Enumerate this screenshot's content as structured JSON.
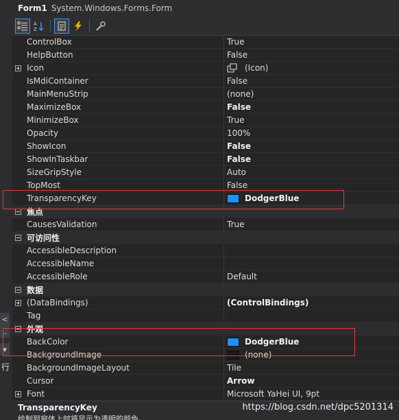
{
  "title": {
    "name": "Form1",
    "type": "System.Windows.Forms.Form"
  },
  "toolbar": {
    "buttons": [
      "categorized-icon",
      "alphabetical-icon",
      "properties-icon",
      "events-icon",
      "property-pages-icon"
    ]
  },
  "rows": [
    {
      "kind": "prop",
      "name": "ControlBox",
      "value": "True",
      "bold": false
    },
    {
      "kind": "prop",
      "name": "HelpButton",
      "value": "False",
      "bold": false
    },
    {
      "kind": "prop",
      "name": "Icon",
      "value": "(Icon)",
      "bold": false,
      "expandable": true,
      "icon": "icon-preview"
    },
    {
      "kind": "prop",
      "name": "IsMdiContainer",
      "value": "False",
      "bold": false
    },
    {
      "kind": "prop",
      "name": "MainMenuStrip",
      "value": "(none)",
      "bold": false
    },
    {
      "kind": "prop",
      "name": "MaximizeBox",
      "value": "False",
      "bold": true
    },
    {
      "kind": "prop",
      "name": "MinimizeBox",
      "value": "True",
      "bold": false
    },
    {
      "kind": "prop",
      "name": "Opacity",
      "value": "100%",
      "bold": false
    },
    {
      "kind": "prop",
      "name": "ShowIcon",
      "value": "False",
      "bold": true
    },
    {
      "kind": "prop",
      "name": "ShowInTaskbar",
      "value": "False",
      "bold": true
    },
    {
      "kind": "prop",
      "name": "SizeGripStyle",
      "value": "Auto",
      "bold": false
    },
    {
      "kind": "prop",
      "name": "TopMost",
      "value": "False",
      "bold": false
    },
    {
      "kind": "prop",
      "name": "TransparencyKey",
      "value": "DodgerBlue",
      "bold": true,
      "swatch": "#1e90ff"
    },
    {
      "kind": "cat",
      "name": "焦点"
    },
    {
      "kind": "prop",
      "name": "CausesValidation",
      "value": "True",
      "bold": false
    },
    {
      "kind": "cat",
      "name": "可访问性"
    },
    {
      "kind": "prop",
      "name": "AccessibleDescription",
      "value": "",
      "bold": false
    },
    {
      "kind": "prop",
      "name": "AccessibleName",
      "value": "",
      "bold": false
    },
    {
      "kind": "prop",
      "name": "AccessibleRole",
      "value": "Default",
      "bold": false
    },
    {
      "kind": "cat",
      "name": "数据"
    },
    {
      "kind": "prop",
      "name": "(DataBindings)",
      "value": "(ControlBindings)",
      "bold": true,
      "expandable": true
    },
    {
      "kind": "prop",
      "name": "Tag",
      "value": "",
      "bold": false
    },
    {
      "kind": "cat",
      "name": "外观"
    },
    {
      "kind": "prop",
      "name": "BackColor",
      "value": "DodgerBlue",
      "bold": true,
      "swatch": "#1e90ff"
    },
    {
      "kind": "prop",
      "name": "BackgroundImage",
      "value": "(none)",
      "bold": false,
      "swatch": "#1a1a1a"
    },
    {
      "kind": "prop",
      "name": "BackgroundImageLayout",
      "value": "Tile",
      "bold": false
    },
    {
      "kind": "prop",
      "name": "Cursor",
      "value": "Arrow",
      "bold": true
    },
    {
      "kind": "prop",
      "name": "Font",
      "value": "Microsoft YaHei UI, 9pt",
      "bold": false,
      "expandable": true
    }
  ],
  "description": {
    "title": "TransparencyKey",
    "text": "绘制到窗体上时将显示为透明的颜色。"
  },
  "watermark": "https://blog.csdn.net/dpc5201314",
  "left_strip": {
    "glyph": "行"
  },
  "colors": {
    "highlight": "#e03c3c",
    "dodgerblue": "#1e90ff"
  }
}
